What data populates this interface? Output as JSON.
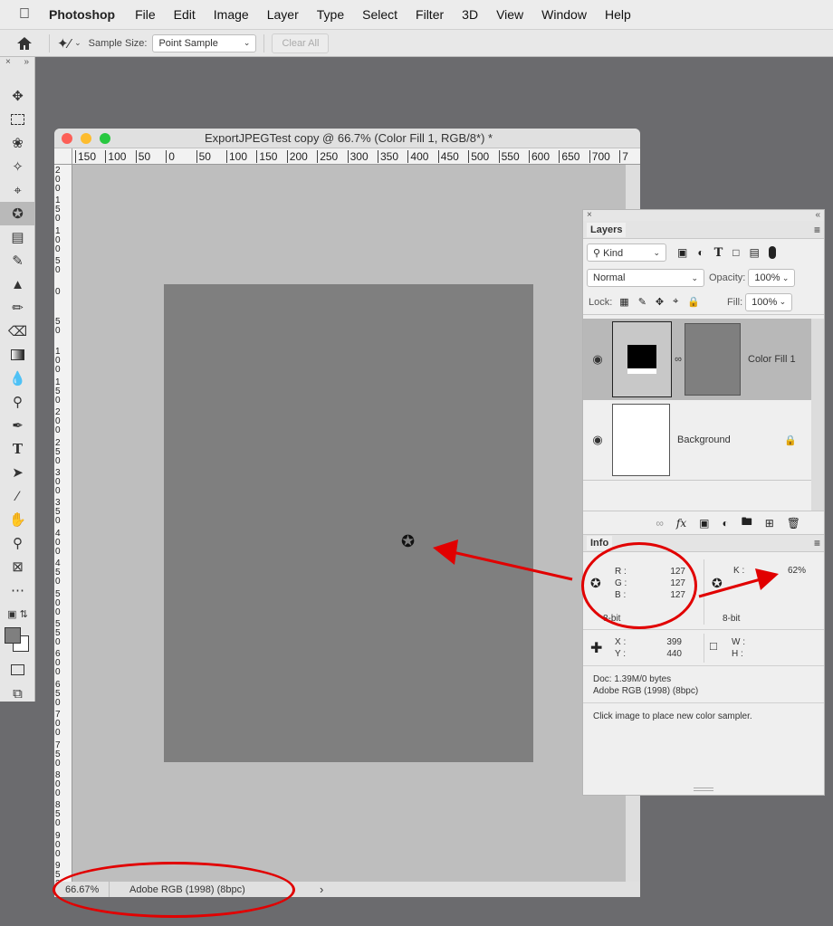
{
  "menubar": {
    "app": "Photoshop",
    "items": [
      "File",
      "Edit",
      "Image",
      "Layer",
      "Type",
      "Select",
      "Filter",
      "3D",
      "View",
      "Window",
      "Help"
    ]
  },
  "options": {
    "sample_size_label": "Sample Size:",
    "sample_size_value": "Point Sample",
    "clear_all": "Clear All"
  },
  "document": {
    "title": "ExportJPEGTest copy @ 66.7% (Color Fill 1, RGB/8*) *",
    "ruler_h": [
      "150",
      "100",
      "50",
      "0",
      "50",
      "100",
      "150",
      "200",
      "250",
      "300",
      "350",
      "400",
      "450",
      "500",
      "550",
      "600",
      "650",
      "700",
      "7"
    ],
    "ruler_v": [
      "2\n0\n0",
      "1\n5\n0",
      "1\n0\n0",
      "5\n0",
      "0",
      "5\n0",
      "1\n0\n0",
      "1\n5\n0",
      "2\n0\n0",
      "2\n5\n0",
      "3\n0\n0",
      "3\n5\n0",
      "4\n0\n0",
      "4\n5\n0",
      "5\n0\n0",
      "5\n5\n0",
      "6\n0\n0",
      "6\n5\n0",
      "7\n0\n0",
      "7\n5\n0",
      "8\n0\n0",
      "8\n5\n0",
      "9\n0\n0",
      "9\n5\n0",
      "1\n0\n0"
    ],
    "zoom": "66.67%",
    "profile": "Adobe RGB (1998) (8bpc)",
    "status_arrow": "›"
  },
  "layers_panel": {
    "tab": "Layers",
    "kind": "Kind",
    "blend_mode": "Normal",
    "opacity_label": "Opacity:",
    "opacity_value": "100%",
    "lock_label": "Lock:",
    "fill_label": "Fill:",
    "fill_value": "100%",
    "layers": [
      {
        "name": "Color Fill 1"
      },
      {
        "name": "Background"
      }
    ]
  },
  "info_panel": {
    "tab": "Info",
    "r_label": "R :",
    "r": "127",
    "g_label": "G :",
    "g": "127",
    "b_label": "B :",
    "b": "127",
    "k_label": "K :",
    "k": "62%",
    "bit_left": "8-bit",
    "bit_right": "8-bit",
    "x_label": "X :",
    "x": "399",
    "y_label": "Y :",
    "y": "440",
    "w_label": "W :",
    "h_label": "H :",
    "doc": "Doc: 1.39M/0 bytes",
    "profile": "Adobe RGB (1998) (8bpc)",
    "hint": "Click image to place new color sampler."
  },
  "colors": {
    "annotation": "#e10000",
    "canvas": "#7f7f7f",
    "pasteboard": "#bebebe"
  }
}
